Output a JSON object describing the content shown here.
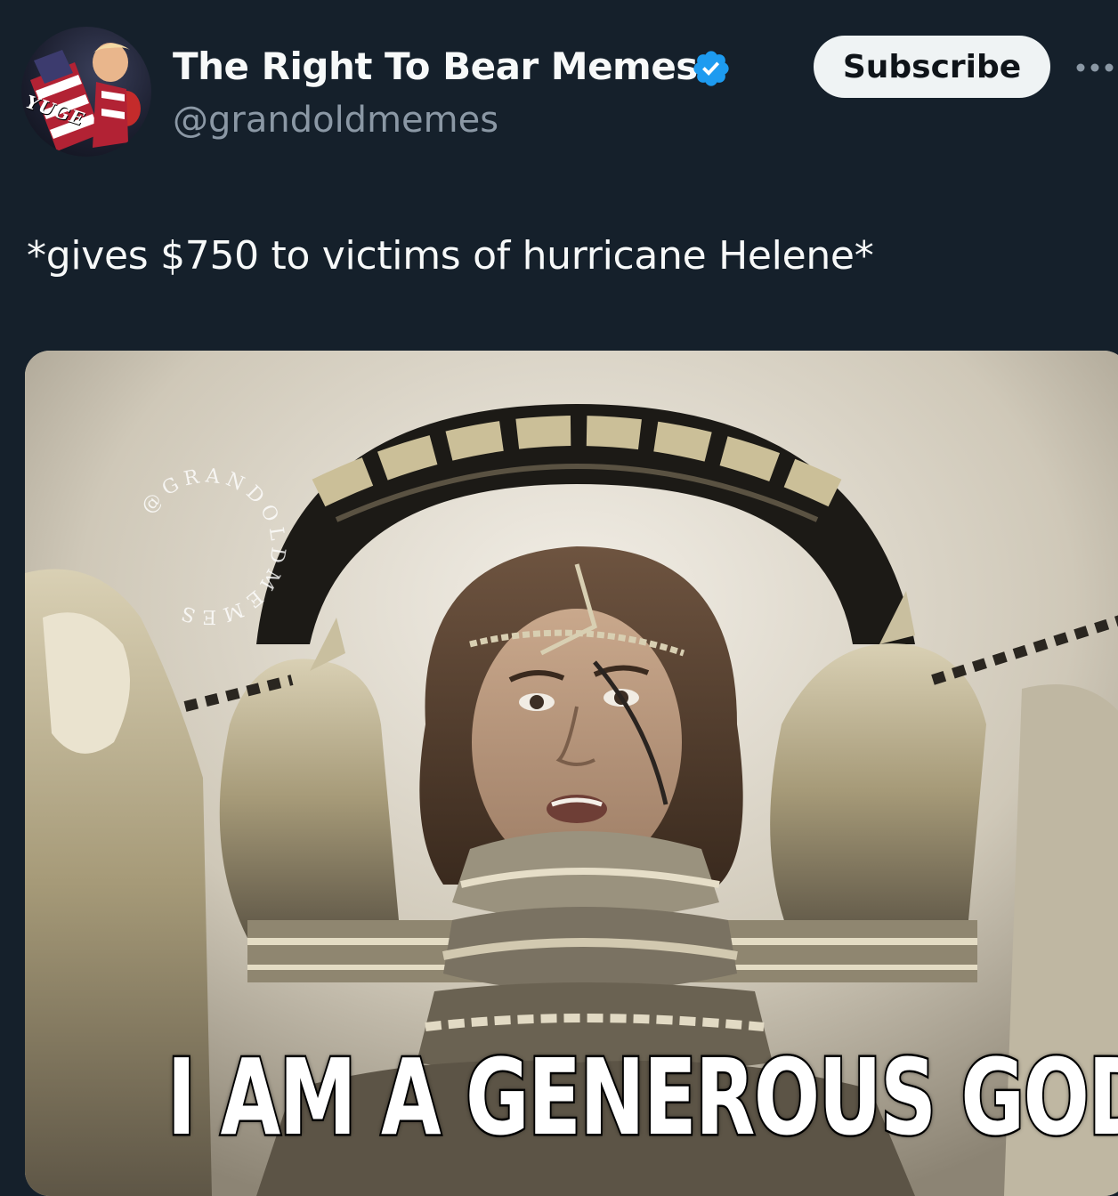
{
  "author": {
    "display_name": "The Right To Bear Memes",
    "handle": "@grandoldmemes",
    "verified": true,
    "avatar_text": "YUGE"
  },
  "actions": {
    "subscribe_label": "Subscribe",
    "more_icon": "more-dots-icon"
  },
  "tweet": {
    "text": "*gives $750 to victims of hurricane Helene*"
  },
  "media": {
    "watermark": "@GRANDOLDMEMES",
    "caption": "I AM A GENEROUS GOD"
  },
  "colors": {
    "background": "#15202b",
    "verified_badge": "#1d9bf0",
    "handle_text": "#8b98a5",
    "button_bg": "#eff3f4"
  }
}
